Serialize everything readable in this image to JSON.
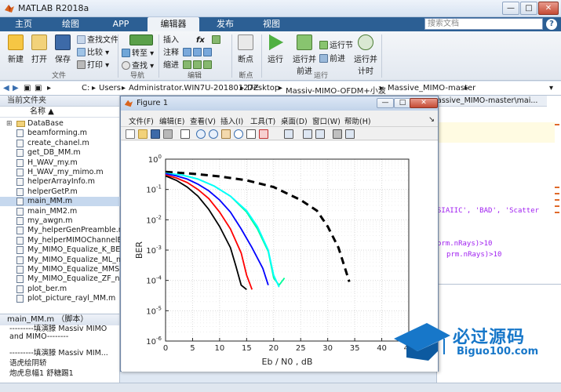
{
  "window": {
    "title": "MATLAB R2018a",
    "min": "—",
    "max": "□",
    "close": "✕"
  },
  "ribbon": {
    "tabs": [
      "主页",
      "绘图",
      "APP",
      "编辑器",
      "发布",
      "视图"
    ],
    "active_tab": "编辑器",
    "search_placeholder": "搜索文档",
    "file_group": {
      "new": "新建",
      "open": "打开",
      "save": "保存",
      "find_files": "查找文件",
      "compare": "比较",
      "print": "打印",
      "label": "文件"
    },
    "nav_group": {
      "goto": "转至",
      "find": "查找",
      "label": "导航"
    },
    "edit_group": {
      "insert": "插入",
      "comment": "注释",
      "indent": "缩进",
      "fx": "fx",
      "label": "编辑"
    },
    "breakpoint_group": {
      "breakpoints": "断点",
      "label": "断点"
    },
    "run_group": {
      "run": "运行",
      "run_advance": "运行并",
      "run_advance2": "前进",
      "run_section": "运行节",
      "advance": "前进",
      "run_time": "运行并",
      "run_time2": "计时",
      "label": "运行"
    }
  },
  "address": {
    "parts": [
      "C:",
      "Users",
      "Administrator.WIN7U-20180127Z",
      "Desktop",
      "Massiv-MIMO-OFDM+小波",
      "Massive_MIMO-master"
    ]
  },
  "folder_panel": {
    "title": "当前文件夹",
    "column": "名称 ▲",
    "items": [
      {
        "name": "DataBase",
        "type": "folder"
      },
      {
        "name": "beamforming.m",
        "type": "file"
      },
      {
        "name": "create_chanel.m",
        "type": "file"
      },
      {
        "name": "get_DB_MM.m",
        "type": "file"
      },
      {
        "name": "H_WAV_my.m",
        "type": "file"
      },
      {
        "name": "H_WAV_my_mimo.m",
        "type": "file"
      },
      {
        "name": "helperArrayInfo.m",
        "type": "file"
      },
      {
        "name": "helperGetP.m",
        "type": "file"
      },
      {
        "name": "main_MM.m",
        "type": "file",
        "selected": true
      },
      {
        "name": "main_MM2.m",
        "type": "file"
      },
      {
        "name": "my_awgn.m",
        "type": "file"
      },
      {
        "name": "My_helperGenPreamble.m",
        "type": "file"
      },
      {
        "name": "My_helperMIMOChannelEs...",
        "type": "file"
      },
      {
        "name": "My_MIMO_Equalize_K_BES...",
        "type": "file"
      },
      {
        "name": "My_MIMO_Equalize_ML_nu...",
        "type": "file"
      },
      {
        "name": "My_MIMO_Equalize_MMSE...",
        "type": "file"
      },
      {
        "name": "My_MIMO_Equalize_ZF_nu...",
        "type": "file"
      },
      {
        "name": "plot_ber.m",
        "type": "file"
      },
      {
        "name": "plot_picture_rayl_MM.m",
        "type": "file"
      }
    ]
  },
  "details": {
    "title": "main_MM.m （脚本）",
    "lines": [
      "---------填演滕 Massiv MIMO",
      "and MIMO--------",
      "---------填演滕 Massiv MIM...",
      "语虎绘阴轿",
      "炮虎息幅1 舒糖踢1"
    ]
  },
  "editor": {
    "tab": "assive_MIMO-master\\mai...",
    "code": [
      "SIAIIC', 'BAD', 'Scatter",
      "prm.nRays)>10",
      "prm.nRays)>10"
    ]
  },
  "figure": {
    "title": "Figure 1",
    "menu": [
      "文件(F)",
      "编辑(E)",
      "查看(V)",
      "插入(I)",
      "工具(T)",
      "桌面(D)",
      "窗口(W)",
      "帮助(H)"
    ]
  },
  "watermark": {
    "text": "必过源码",
    "sub": "Biguo100.com"
  },
  "chart_data": {
    "type": "line",
    "title": "",
    "xlabel": "Eb / N0 , dB",
    "ylabel": "BER",
    "xlim": [
      0,
      45
    ],
    "ylim": [
      1e-06,
      1
    ],
    "yscale": "log",
    "xticks": [
      0,
      5,
      10,
      15,
      20,
      25,
      30,
      35,
      40,
      45
    ],
    "yticks": [
      "10^0",
      "10^-1",
      "10^-2",
      "10^-3",
      "10^-4",
      "10^-5",
      "10^-6"
    ],
    "grid": true,
    "series": [
      {
        "color": "#000000",
        "style": "dashed",
        "x": [
          0,
          5,
          10,
          15,
          20,
          25,
          28,
          30,
          32,
          34
        ],
        "y": [
          0.38,
          0.33,
          0.27,
          0.2,
          0.12,
          0.045,
          0.02,
          0.006,
          0.0012,
          9e-05
        ]
      },
      {
        "color": "#00ff99",
        "style": "solid",
        "x": [
          0,
          3,
          6,
          9,
          12,
          15,
          17,
          19,
          20,
          21,
          22
        ],
        "y": [
          0.34,
          0.3,
          0.22,
          0.13,
          0.06,
          0.018,
          0.005,
          0.0009,
          0.00012,
          7e-05,
          0.00012
        ]
      },
      {
        "color": "#00ffff",
        "style": "solid",
        "x": [
          0,
          3,
          6,
          9,
          12,
          15,
          17,
          19,
          20,
          21
        ],
        "y": [
          0.34,
          0.3,
          0.22,
          0.13,
          0.06,
          0.02,
          0.006,
          0.001,
          0.00015,
          6e-05
        ]
      },
      {
        "color": "#0000ff",
        "style": "solid",
        "x": [
          0,
          2,
          4,
          6,
          8,
          10,
          12,
          14,
          16,
          18,
          19
        ],
        "y": [
          0.33,
          0.28,
          0.22,
          0.15,
          0.09,
          0.045,
          0.018,
          0.005,
          0.0012,
          0.00025,
          7e-05
        ]
      },
      {
        "color": "#ff0000",
        "style": "solid",
        "x": [
          0,
          2,
          4,
          6,
          8,
          10,
          12,
          14,
          15,
          16
        ],
        "y": [
          0.3,
          0.24,
          0.17,
          0.1,
          0.05,
          0.018,
          0.005,
          0.0008,
          0.00015,
          5e-05
        ]
      },
      {
        "color": "#000000",
        "style": "solid",
        "x": [
          0,
          2,
          4,
          6,
          8,
          10,
          12,
          13,
          14,
          15
        ],
        "y": [
          0.28,
          0.2,
          0.12,
          0.06,
          0.022,
          0.006,
          0.0012,
          0.0003,
          7e-05,
          5e-05
        ]
      }
    ]
  }
}
